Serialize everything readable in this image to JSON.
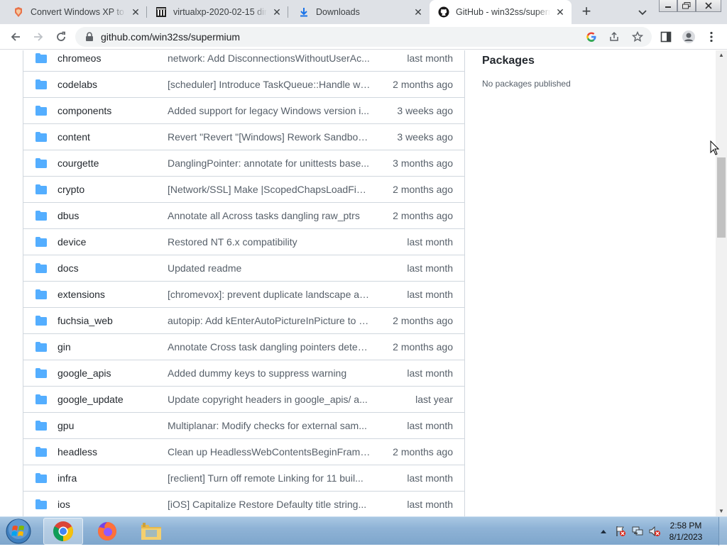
{
  "browser": {
    "tabs": [
      {
        "title": "Convert Windows XP to a",
        "close": "✕"
      },
      {
        "title": "virtualxp-2020-02-15 dire",
        "close": "✕"
      },
      {
        "title": "Downloads",
        "close": "✕"
      },
      {
        "title": "GitHub - win32ss/superm",
        "close": "✕",
        "active": true
      }
    ],
    "new_tab": "+",
    "url": "github.com/win32ss/supermium"
  },
  "files": [
    {
      "name": "chromeos",
      "message": "network: Add DisconnectionsWithoutUserAc...",
      "age": "last month"
    },
    {
      "name": "codelabs",
      "message": "[scheduler] Introduce TaskQueue::Handle wh...",
      "age": "2 months ago"
    },
    {
      "name": "components",
      "message": "Added support for legacy Windows version i...",
      "age": "3 weeks ago"
    },
    {
      "name": "content",
      "message": "Revert \"Revert \"[Windows] Rework Sandbox ...",
      "age": "3 weeks ago"
    },
    {
      "name": "courgette",
      "message": "DanglingPointer: annotate for unittests base...",
      "age": "3 months ago"
    },
    {
      "name": "crypto",
      "message": "[Network/SSL] Make |ScopedChapsLoadFixu...",
      "age": "2 months ago"
    },
    {
      "name": "dbus",
      "message": "Annotate all Across tasks dangling raw_ptrs",
      "age": "2 months ago"
    },
    {
      "name": "device",
      "message": "Restored NT 6.x compatibility",
      "age": "last month"
    },
    {
      "name": "docs",
      "message": "Updated readme",
      "age": "last month"
    },
    {
      "name": "extensions",
      "message": "[chromevox]: prevent duplicate landscape an...",
      "age": "last month"
    },
    {
      "name": "fuchsia_web",
      "message": "autopip: Add kEnterAutoPictureInPicture to s...",
      "age": "2 months ago"
    },
    {
      "name": "gin",
      "message": "Annotate Cross task dangling pointers detec...",
      "age": "2 months ago"
    },
    {
      "name": "google_apis",
      "message": "Added dummy keys to suppress warning",
      "age": "last month"
    },
    {
      "name": "google_update",
      "message": "Update copyright headers in google_apis/ a...",
      "age": "last year"
    },
    {
      "name": "gpu",
      "message": "Multiplanar: Modify checks for external sam...",
      "age": "last month"
    },
    {
      "name": "headless",
      "message": "Clean up HeadlessWebContentsBeginFrame...",
      "age": "2 months ago"
    },
    {
      "name": "infra",
      "message": "[reclient] Turn off remote Linking for 11 buil...",
      "age": "last month"
    },
    {
      "name": "ios",
      "message": "[iOS] Capitalize Restore Defaulty title string...",
      "age": "last month"
    }
  ],
  "sidebar": {
    "packages_heading": "Packages",
    "packages_text": "No packages published"
  },
  "taskbar": {
    "time": "2:58 PM",
    "date": "8/1/2023"
  },
  "colors": {
    "folder": "#54aeff",
    "link_text": "#24292f",
    "muted_text": "#57606a",
    "border": "#d0d7de"
  }
}
